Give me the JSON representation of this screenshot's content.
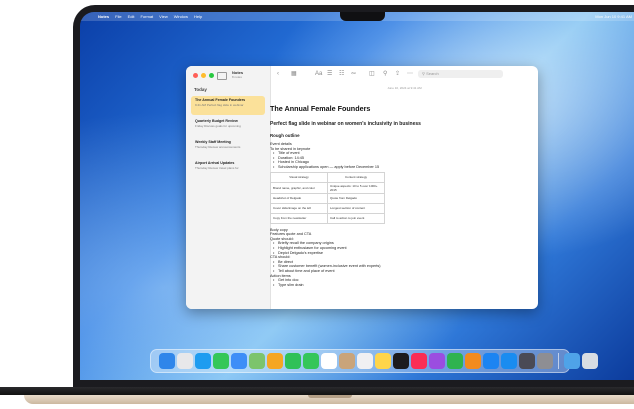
{
  "menubar": {
    "apple": "",
    "menus": [
      "Notes",
      "File",
      "Edit",
      "Format",
      "View",
      "Window",
      "Help"
    ],
    "status": [
      "",
      "",
      "",
      "",
      "",
      "Mon Jun 10  9:41 AM"
    ]
  },
  "window": {
    "sidebar": {
      "folder_title": "Notes",
      "folder_count": "8 notes",
      "section": "Today",
      "notes": [
        {
          "title": "The Annual Female Founders",
          "preview": "9:41 AM  Perfect flag slide in webinar"
        },
        {
          "title": "Quarterly Budget Review",
          "preview": "Friday  Discuss goals for upcoming"
        },
        {
          "title": "Weekly Staff Meeting",
          "preview": "Thursday  Review announcements"
        },
        {
          "title": "Airport Arrival Updates",
          "preview": "Thursday  Review travel plans for"
        }
      ]
    },
    "toolbar": {
      "search_placeholder": "Search"
    },
    "date": "June 10, 2024 at 9:41 AM",
    "doc": {
      "title": "The Annual Female Founders",
      "subtitle": "Perfect flag slide in webinar on women's inclusivity in business",
      "section": "Rough outline",
      "event_heading": "Event details",
      "share_line": "To be shared in keynote",
      "event_items": [
        "Title of event",
        "Duration: 14:45",
        "Hosted in Chicago",
        "Scholarship applications open — apply before December 15"
      ],
      "table": {
        "headers": [
          "Visual strategy",
          "Content strategy"
        ],
        "rows": [
          [
            "Brand name, graphic, and color",
            "Unique aspects: 10 to 5 over 1000+ 2015"
          ],
          [
            "Headshot of Delgado",
            "Quote from Delgado"
          ],
          [
            "Cover slide/image on the left",
            "Longest section of content"
          ],
          [
            "Copy from the newsletter",
            "Call to action to join event"
          ]
        ]
      },
      "body_copy": "Body copy",
      "features_line": "Features quote and CTA",
      "quote_heading": "Quote should:",
      "quote_items": [
        "Briefly recall the company origins",
        "Highlight enthusiasm for upcoming event",
        "Depict Delgado's expertise"
      ],
      "cta_heading": "CTA should:",
      "cta_items": [
        "Be direct",
        "Share customer benefit (women-inclusive event with experts)",
        "Tell about time and place of event"
      ],
      "action_heading": "Action items",
      "action_items": [
        "Get into doc",
        "Type slim drain"
      ]
    }
  },
  "dock": {
    "apps": [
      {
        "name": "finder",
        "color": "#2f86ea"
      },
      {
        "name": "launchpad",
        "color": "#e8e8ea"
      },
      {
        "name": "safari",
        "color": "#1e9cf0"
      },
      {
        "name": "messages",
        "color": "#34c759"
      },
      {
        "name": "mail",
        "color": "#3e8ef7"
      },
      {
        "name": "maps",
        "color": "#7cc46c"
      },
      {
        "name": "photos",
        "color": "#f5a623"
      },
      {
        "name": "facetime",
        "color": "#2fc158"
      },
      {
        "name": "phone",
        "color": "#35c65a"
      },
      {
        "name": "calendar",
        "color": "#ffffff"
      },
      {
        "name": "contacts",
        "color": "#c9a47a"
      },
      {
        "name": "reminders",
        "color": "#f0f0f2"
      },
      {
        "name": "notes",
        "color": "#ffd54a"
      },
      {
        "name": "tv",
        "color": "#1c1c1e"
      },
      {
        "name": "music",
        "color": "#fa2d55"
      },
      {
        "name": "podcasts",
        "color": "#9b4de0"
      },
      {
        "name": "numbers",
        "color": "#2fb350"
      },
      {
        "name": "pages",
        "color": "#f28b1e"
      },
      {
        "name": "keynote",
        "color": "#1c84f2"
      },
      {
        "name": "app-store",
        "color": "#1a8cf0"
      },
      {
        "name": "iphone-mirroring",
        "color": "#4a4a55"
      },
      {
        "name": "system-settings",
        "color": "#8e8e93"
      }
    ],
    "trailing": [
      {
        "name": "downloads-folder",
        "color": "#4fa3e8"
      },
      {
        "name": "trash",
        "color": "#d8dde3"
      }
    ]
  }
}
